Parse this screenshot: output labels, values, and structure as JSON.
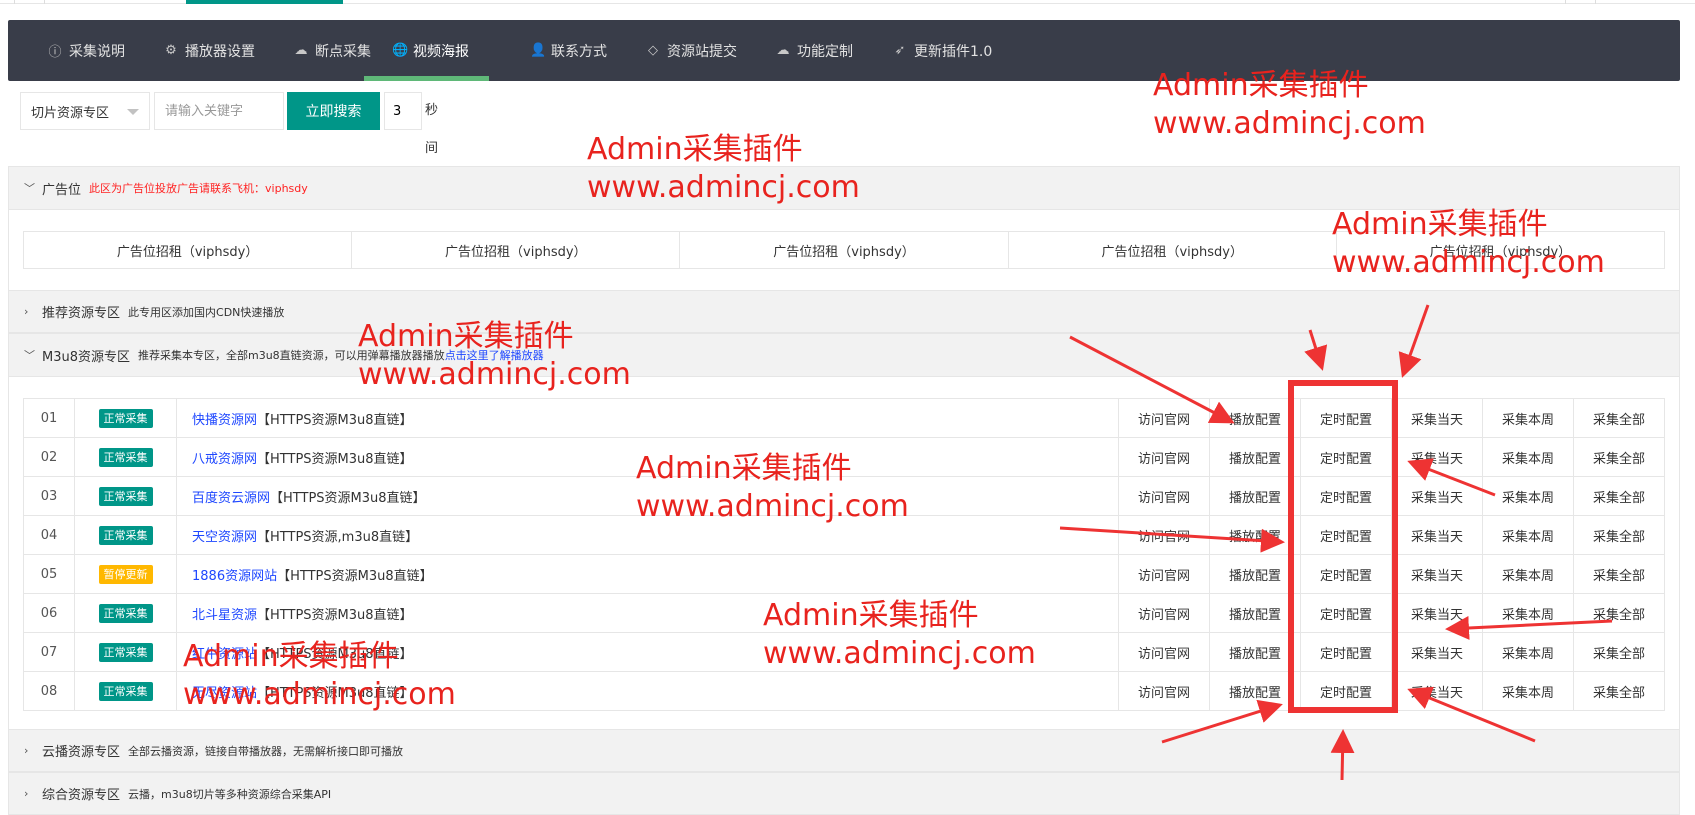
{
  "nav": {
    "items": [
      {
        "icon": "info-circle-icon",
        "label": "采集说明"
      },
      {
        "icon": "gear-icon",
        "label": "播放器设置"
      },
      {
        "icon": "cloud-icon",
        "label": "断点采集"
      },
      {
        "icon": "globe-icon",
        "label": "视频海报",
        "active": true
      },
      {
        "icon": "user-icon",
        "label": "联系方式"
      },
      {
        "icon": "diamond-icon",
        "label": "资源站提交"
      },
      {
        "icon": "cloud-icon",
        "label": "功能定制"
      },
      {
        "icon": "paper-plane-icon",
        "label": "更新插件1.0"
      }
    ]
  },
  "toolbar": {
    "select_value": "切片资源专区",
    "search_placeholder": "请输入关键字",
    "search_button": "立即搜索",
    "interval_value": "3",
    "interval_label": "秒间隔"
  },
  "ad_panel": {
    "title": "广告位",
    "desc": "此区为广告位投放广告请联系飞机：viphsdy",
    "slots": [
      "广告位招租（viphsdy）",
      "广告位招租（viphsdy）",
      "广告位招租（viphsdy）",
      "广告位招租（viphsdy）",
      "广告位招租（viphsdy）"
    ]
  },
  "recommend_panel": {
    "title": "推荐资源专区",
    "desc": "此专用区添加国内CDN快速播放"
  },
  "m3u8_panel": {
    "title": "M3u8资源专区",
    "desc": "推荐采集本专区，全部m3u8直链资源，可以用弹幕播放器播放",
    "link": "点击这里了解播放器"
  },
  "actions": [
    "访问官网",
    "播放配置",
    "定时配置",
    "采集当天",
    "采集本周",
    "采集全部"
  ],
  "rows": [
    {
      "num": "01",
      "status": "正常采集",
      "warn": false,
      "name": "快播资源网",
      "suffix": "【HTTPS资源M3u8直链】"
    },
    {
      "num": "02",
      "status": "正常采集",
      "warn": false,
      "name": "八戒资源网",
      "suffix": "【HTTPS资源M3u8直链】"
    },
    {
      "num": "03",
      "status": "正常采集",
      "warn": false,
      "name": "百度资云源网",
      "suffix": "【HTTPS资源M3u8直链】"
    },
    {
      "num": "04",
      "status": "正常采集",
      "warn": false,
      "name": "天空资源网",
      "suffix": "【HTTPS资源,m3u8直链】"
    },
    {
      "num": "05",
      "status": "暂停更新",
      "warn": true,
      "name": "1886资源网站",
      "suffix": "【HTTPS资源M3u8直链】"
    },
    {
      "num": "06",
      "status": "正常采集",
      "warn": false,
      "name": "北斗星资源",
      "suffix": "【HTTPS资源M3u8直链】"
    },
    {
      "num": "07",
      "status": "正常采集",
      "warn": false,
      "name": "红牛资源站",
      "suffix": "【HTTPS资源M3u8直链】"
    },
    {
      "num": "08",
      "status": "正常采集",
      "warn": false,
      "name": "无尽资源站",
      "suffix": "【HTTPS资源M3u8直链】"
    }
  ],
  "cloud_panel": {
    "title": "云播资源专区",
    "desc": "全部云播资源，链接自带播放器，无需解析接口即可播放"
  },
  "combo_panel": {
    "title": "综合资源专区",
    "desc": "云播，m3u8切片等多种资源综合采集API"
  },
  "watermark": {
    "line1": "Admin采集插件",
    "line2": "www.admincj.com"
  },
  "colors": {
    "primary": "#009688",
    "nav_bg": "#393d49",
    "nav_active": "#5fb878",
    "warn": "#ffb800",
    "link": "#1e47ff",
    "annotation": "#e8231e"
  }
}
